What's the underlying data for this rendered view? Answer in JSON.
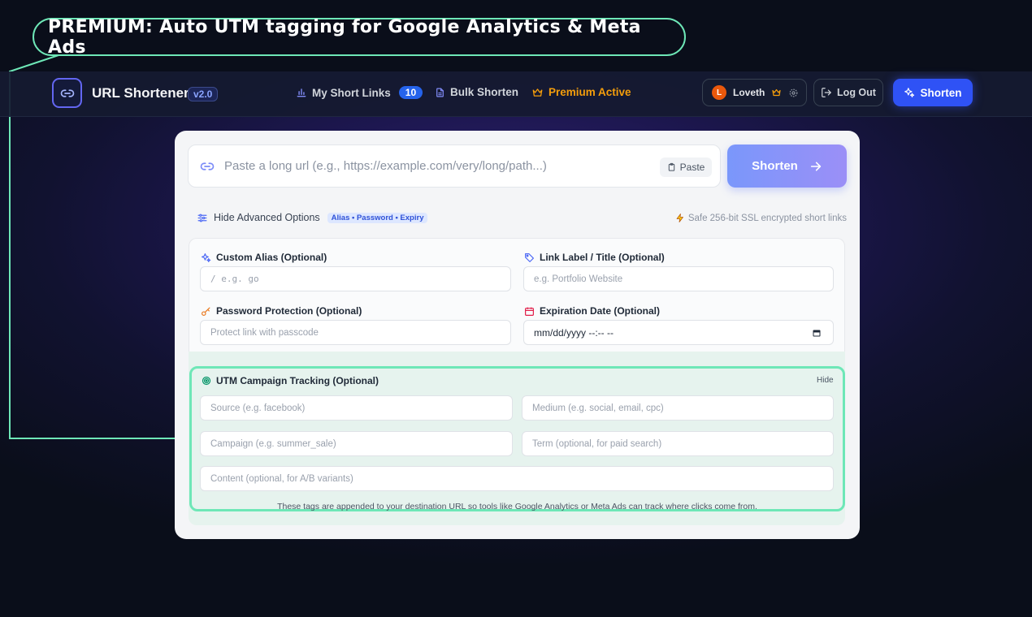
{
  "callout": {
    "text": "PREMIUM: Auto UTM tagging for Google Analytics & Meta Ads"
  },
  "header": {
    "app_title": "URL Shortener",
    "version": "v2.0",
    "nav": {
      "my_links": "My Short Links",
      "my_links_count": "10",
      "bulk": "Bulk Shorten",
      "premium": "Premium Active"
    },
    "user": {
      "initial": "L",
      "name": "Loveth"
    },
    "logout": "Log Out",
    "shorten": "Shorten"
  },
  "main": {
    "url_placeholder": "Paste a long url (e.g., https://example.com/very/long/path...)",
    "paste": "Paste",
    "shorten": "Shorten",
    "adv_toggle": "Hide Advanced Options",
    "adv_tag": "Alias • Password • Expiry",
    "ssl_note": "Safe 256-bit SSL encrypted short links",
    "fields": {
      "alias_label": "Custom Alias (Optional)",
      "alias_placeholder": "/  e.g. go",
      "label_label": "Link Label / Title (Optional)",
      "label_placeholder": "e.g. Portfolio Website",
      "password_label": "Password Protection (Optional)",
      "password_placeholder": "Protect link with passcode",
      "expiry_label": "Expiration Date (Optional)",
      "expiry_value": "mm/dd/yyyy --:-- --"
    },
    "utm": {
      "title": "UTM Campaign Tracking (Optional)",
      "hide": "Hide",
      "source": "Source (e.g. facebook)",
      "medium": "Medium (e.g. social, email, cpc)",
      "campaign": "Campaign (e.g. summer_sale)",
      "term": "Term (optional, for paid search)",
      "content": "Content (optional, for A/B variants)",
      "note": "These tags are appended to your destination URL so tools like Google Analytics or Meta Ads can track where clicks come from."
    }
  },
  "colors": {
    "accent": "#2f52f5",
    "highlight": "#6ee7b7",
    "premium": "#f59e0b"
  }
}
